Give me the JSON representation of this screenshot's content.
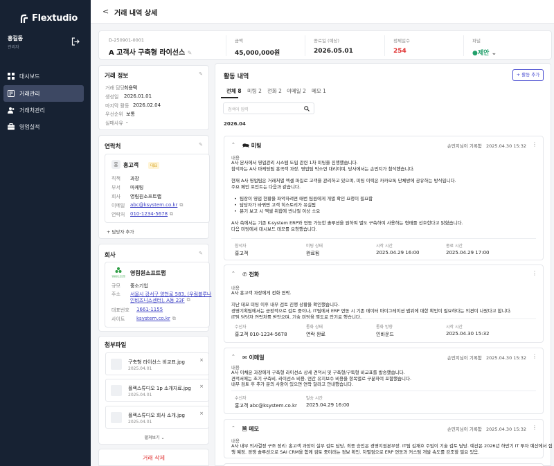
{
  "app": {
    "logo_text": "Flextudio",
    "user_name": "홍길동",
    "user_role": "관리자"
  },
  "nav": [
    {
      "label": "대시보드",
      "icon": "grid-icon"
    },
    {
      "label": "거래관리",
      "icon": "deal-icon",
      "active": true
    },
    {
      "label": "거래처관리",
      "icon": "people-icon"
    },
    {
      "label": "영업실적",
      "icon": "briefcase-icon"
    }
  ],
  "page": {
    "back": "<",
    "title": "거래 내역 상세"
  },
  "deal": {
    "id": "D-250901-0001",
    "name": "A 고객사 구축형 라이선스",
    "amount_label": "금액",
    "amount": "45,000,000원",
    "close_label": "종료일 (예상)",
    "close": "2026.05.01",
    "stay_label": "정체일수",
    "stay": "254",
    "stage_label": "파널",
    "stage": "제안",
    "accent": "#e03131",
    "stage_color": "#22a06b"
  },
  "info": {
    "title": "거래 정보",
    "rows": [
      {
        "k": "거래 담당",
        "v": "최용택"
      },
      {
        "k": "생성일",
        "v": "2026.01.01"
      },
      {
        "k": "마지막 활동",
        "v": "2026.02.04"
      },
      {
        "k": "우선순위",
        "v": "보통"
      },
      {
        "k": "실패사유",
        "v": "-"
      }
    ]
  },
  "contact": {
    "title": "연락처",
    "avatar": "홍",
    "name": "홍고객",
    "tag": "대표",
    "rows": [
      {
        "k": "직책",
        "v": "과장"
      },
      {
        "k": "부서",
        "v": "마케팅"
      },
      {
        "k": "회사",
        "v": "영림원소프트랩"
      },
      {
        "k": "이메일",
        "v": "abc@ksystem.co.kr"
      },
      {
        "k": "연락처",
        "v": "010-1234-5678"
      }
    ],
    "add": "+ 담당자 추가"
  },
  "company": {
    "title": "회사",
    "logo_text": "영림원소프트랩",
    "name": "영림원소프트랩",
    "rows": [
      {
        "k": "규모",
        "v": "중소기업"
      },
      {
        "k": "주소",
        "v": "서울시 강서구 양천로 583, (우림블루나"
      },
      {
        "k": "",
        "v": "인비즈니스센터), A동 23F"
      },
      {
        "k": "대표번호",
        "v": "1661-1155"
      },
      {
        "k": "사이트",
        "v": "ksystem.co.kr"
      }
    ]
  },
  "files": {
    "title": "첨부파일",
    "more": "펼쳐보기",
    "items": [
      {
        "name": "구축형 라이선스 비교표.jpg",
        "date": "2025.04.01"
      },
      {
        "name": "플렉스튜디오 1p 소개자료.jpg",
        "date": "2025.04.01"
      },
      {
        "name": "플렉스튜디오 회사 소개.jpg",
        "date": "2025.04.01"
      }
    ]
  },
  "delete_label": "거래 삭제",
  "activity": {
    "title": "활동 내역",
    "add": "+ 활동 추가",
    "tabs": [
      "전체 8",
      "미팅 2",
      "전화 2",
      "이메일 2",
      "메모 1"
    ],
    "search_placeholder": "검색어 입력",
    "date_group": "2026.04",
    "items": [
      {
        "type": "미팅",
        "author": "손민지님이 기록함",
        "date": "2025.04.30 15:32",
        "label": "내용",
        "body": "A사 본사에서 영업관리 시스템 도입 관련 1차 미팅을 진행했습니다.\n참석자는 A사 마케팅팀 홍곡객 과장, 영업팀 박소연 대리이며, 당사에서는 손민지가 참석했습니다.\n\n현재 A사 영업팀은 거래처별 엑셀 파일로 고객을 관리하고 있으며, 미팅 이력은 카카오톡 단체방에 공유하는 방식입니다.\n주요 페인 포인트는 다음과 같습니다.\n\n  •  팀장이 영업 현황을 파악하려면 매번 팀원에게 개별 확인 요청이 필요함\n  •  담당자가 바뀌면 고객 히스토리가 유실됨\n  •  분기 보고 시 엑셀 취합에 반나절 이상 소요\n\nA사 측에서는 기존 K-system ERP와 연동 가능한 솔루션을 원하며 별도 구축하여 사용하는 형태를 선호한다고 밝혔습니다.\n다음 미팅에서 대시보드 데모를 요청했습니다.",
        "fields": [
          {
            "k": "참석자",
            "v": "홍고객"
          },
          {
            "k": "미팅 상태",
            "v": "완료됨"
          },
          {
            "k": "시작 시간",
            "v": "2025.04.29 16:00"
          },
          {
            "k": "종료 시간",
            "v": "2025.04.29 17:00"
          }
        ]
      },
      {
        "type": "전화",
        "author": "손민지님이 기록함",
        "date": "2025.04.30 15:32",
        "label": "내용",
        "body": "A사 홍고객 과장에게 전화 연락.\n\n지난 데모 미팅 이후 내부 검토 진행 상황을 확인했습니다.\n경영기획팀에서는 긍정적으로 검토 중이나, IT팀에서 ERP 연동 시 기존 데이터 마이그레이션 범위에 대한 확인이 필요하다는 의견이 나왔다고 합니다.\nIT팀 담당자 연락처를 받았으며, 기술 미팅을 별도로 잡기로 했습니다.",
        "fields": [
          {
            "k": "수신자",
            "v": "홍고객 010-1234-5678"
          },
          {
            "k": "통화 상태",
            "v": "연락 완료"
          },
          {
            "k": "통화 방향",
            "v": "인바운드"
          },
          {
            "k": "시작 시간",
            "v": "2025.04.30 15:32"
          }
        ]
      },
      {
        "type": "이메일",
        "author": "손민지님이 기록함",
        "date": "2025.04.30 15:32",
        "label": "내용",
        "body": "A사 이채윤 과장에게 구축형 라이선스 상세 견적서 및 구축형/구독형 비교표를 발송했습니다.\n견적서에는 초기 구축비, 라이선스 비용, 연간 유지보수 비용을 항목별로 구분하여 포함했습니다.\n내부 검토 후 추가 문의 사항이 있으면 연락 달라고 안내했습니다.",
        "fields": [
          {
            "k": "수신자",
            "v": "홍고객 abc@ksystem.co.kr"
          },
          {
            "k": "발송 시간",
            "v": "2025.04.29 16:00"
          }
        ]
      },
      {
        "type": "메모",
        "author": "손민지님이 기록함",
        "date": "2025.04.30 15:32",
        "label": "내용",
        "body": "A사 내부 의사결정 구조 정리: 홍고객 과장이 실무 검토 담당, 최종 승인은 경영지원본부장. IT팀 김재호 주임이 기술 검토 담당. 예산은 2026년 하반기 IT 투자 예산에서 집\n행 예정. 경쟁 솔루션으로 SAI CRM을 함께 검토 중이라는 정보 확인. 차별점으로 ERP 연동과 커스텀 개발 속도를 강조할 필요 있음.",
        "fields": []
      }
    ]
  }
}
